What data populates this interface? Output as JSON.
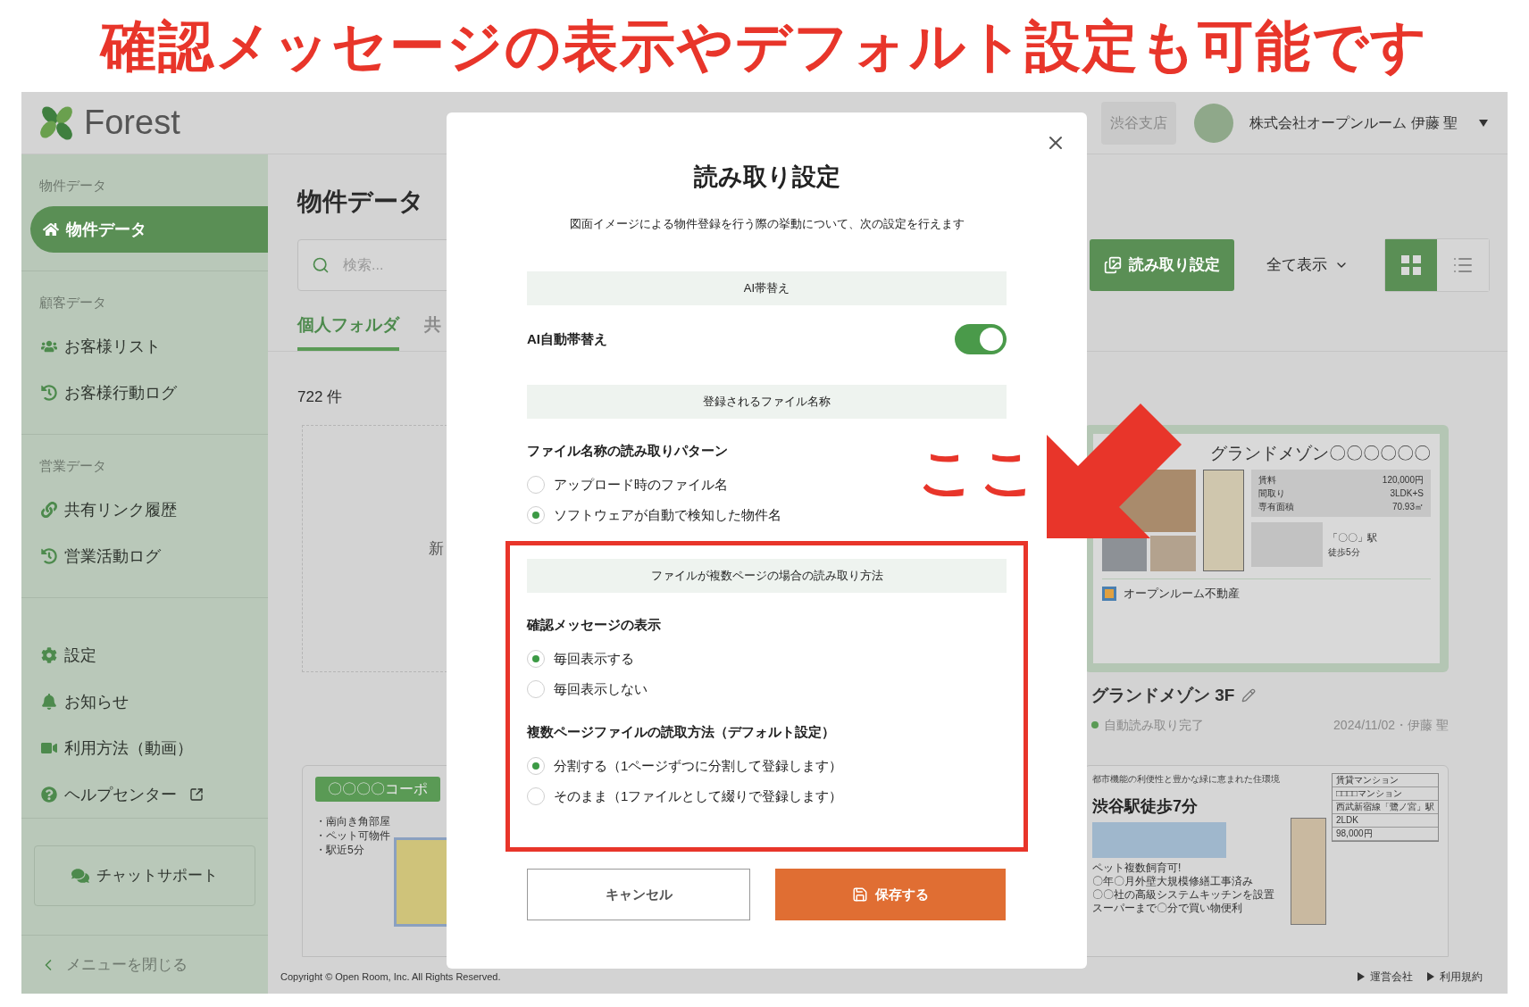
{
  "headline": "確認メッセージの表示やデフォルト設定も可能です",
  "annotation": {
    "label": "ここ"
  },
  "header": {
    "logo": "Forest",
    "branch": "渋谷支店",
    "user": "株式会社オープンルーム 伊藤 聖"
  },
  "sidebar": {
    "sections": [
      {
        "heading": "物件データ",
        "items": [
          {
            "label": "物件データ",
            "selected": true
          }
        ]
      },
      {
        "heading": "顧客データ",
        "items": [
          {
            "label": "お客様リスト",
            "selected": false
          },
          {
            "label": "お客様行動ログ",
            "selected": false
          }
        ]
      },
      {
        "heading": "営業データ",
        "items": [
          {
            "label": "共有リンク履歴",
            "selected": false
          },
          {
            "label": "営業活動ログ",
            "selected": false
          }
        ]
      },
      {
        "items": [
          {
            "label": "設定",
            "selected": false
          },
          {
            "label": "お知らせ",
            "selected": false
          },
          {
            "label": "利用方法（動画）",
            "selected": false
          },
          {
            "label": "ヘルプセンター",
            "selected": false
          }
        ]
      }
    ],
    "chat_button": "チャットサポート",
    "close_menu": "メニューを閉じる"
  },
  "main": {
    "title": "物件データ",
    "search": {
      "placeholder": "検索..."
    },
    "tabs": [
      {
        "label": "個人フォルダ",
        "selected": true
      },
      {
        "label": "共",
        "selected": false
      }
    ],
    "read_settings_button": "読み取り設定",
    "filter": "全て表示",
    "views": [
      {
        "kind": "grid",
        "selected": true
      },
      {
        "kind": "list",
        "selected": false
      }
    ],
    "count": "722 件",
    "new_card": "新",
    "flyer_left": {
      "banner": "〇〇〇〇コーポ",
      "bullets": [
        "・南向き角部屋",
        "・ペット可物件",
        "・駅近5分"
      ]
    },
    "flyer_top": {
      "name": "グランドメゾン〇〇〇〇〇〇",
      "specs": [
        {
          "label": "賃料",
          "value": "120,000円"
        },
        {
          "label": "間取り",
          "value": "3LDK+S"
        },
        {
          "label": "専有面積",
          "value": "70.93㎡"
        }
      ],
      "station": "「〇〇」駅",
      "walk": "徒歩5分",
      "company": "オープンルーム不動産"
    },
    "property": {
      "title": "グランドメゾン 3F",
      "status": "自動読み取り完了",
      "meta": "2024/11/02・伊藤 聖"
    },
    "flyer_bottom": {
      "tagline": "都市機能の利便性と豊かな緑に恵まれた住環境",
      "headline": "渋谷駅徒歩7分",
      "points": [
        "ペット複数飼育可!",
        "〇年〇月外壁大規模修繕工事済み",
        "〇〇社の高級システムキッチンを設置",
        "スーパーまで〇分で買い物便利"
      ],
      "table": [
        "賃貸マンション",
        "□□□□マンション",
        "西武新宿線「鷺ノ宮」駅",
        "2LDK",
        "98,000円"
      ]
    }
  },
  "footer": {
    "copyright": "Copyright © Open Room, Inc. All Rights Reserved.",
    "links": [
      "運営会社",
      "利用規約"
    ]
  },
  "dialog": {
    "title": "読み取り設定",
    "description": "図面イメージによる物件登録を行う際の挙動について、次の設定を行えます",
    "sections": [
      {
        "heading": "AI帯替え",
        "highlighted": false,
        "rows": [
          {
            "kind": "toggle",
            "label": "AI自動帯替え",
            "on": true
          }
        ]
      },
      {
        "heading": "登録されるファイル名称",
        "highlighted": false,
        "rows": [
          {
            "kind": "radio",
            "label": "ファイル名称の読み取りパターン",
            "options": [
              {
                "label": "アップロード時のファイル名",
                "selected": false
              },
              {
                "label": "ソフトウェアが自動で検知した物件名",
                "selected": true
              }
            ]
          }
        ]
      },
      {
        "heading": "ファイルが複数ページの場合の読み取り方法",
        "highlighted": true,
        "rows": [
          {
            "kind": "radio",
            "label": "確認メッセージの表示",
            "options": [
              {
                "label": "毎回表示する",
                "selected": true
              },
              {
                "label": "毎回表示しない",
                "selected": false
              }
            ]
          },
          {
            "kind": "radio",
            "label": "複数ページファイルの読取方法（デフォルト設定）",
            "options": [
              {
                "label": "分割する（1ページずつに分割して登録します）",
                "selected": true
              },
              {
                "label": "そのまま（1ファイルとして綴りで登録します）",
                "selected": false
              }
            ]
          }
        ]
      }
    ],
    "buttons": [
      {
        "kind": "secondary",
        "label": "キャンセル"
      },
      {
        "kind": "primary",
        "label": "保存する"
      }
    ]
  }
}
